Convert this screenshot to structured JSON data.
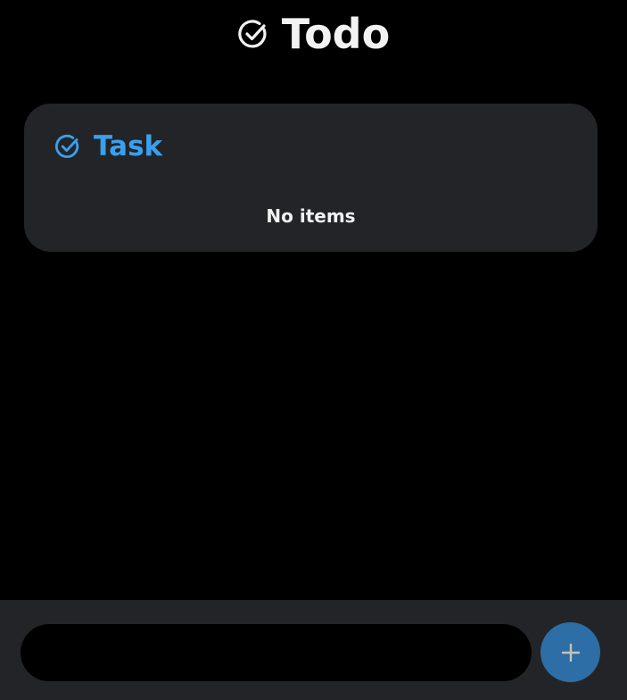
{
  "header": {
    "title": "Todo",
    "icon": "check-circle-icon"
  },
  "task_card": {
    "title": "Task",
    "icon": "check-circle-icon",
    "empty_text": "No items"
  },
  "composer": {
    "input_value": "",
    "input_placeholder": "",
    "add_icon": "plus-icon"
  },
  "colors": {
    "background": "#000000",
    "card": "#232427",
    "accent": "#3aa0ee",
    "add_button": "#2d6ea6",
    "text": "#f2f2f2"
  }
}
